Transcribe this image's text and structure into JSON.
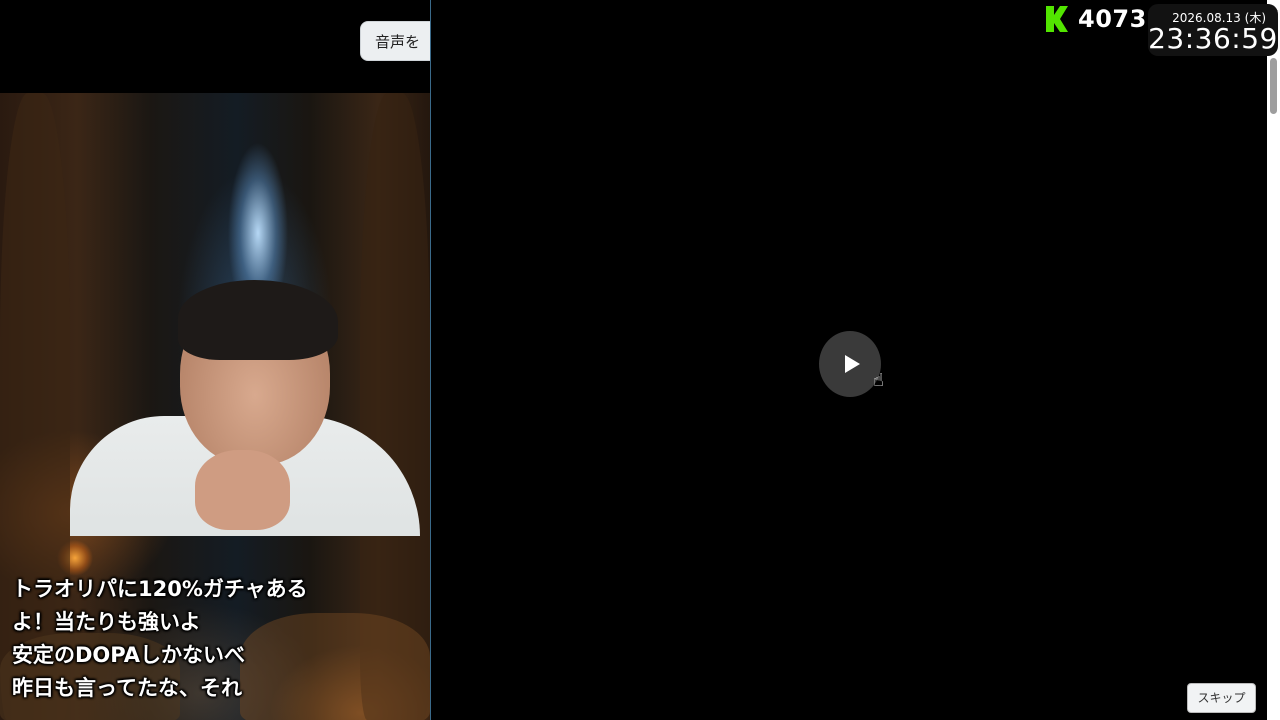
{
  "stream": {
    "audio_button_label": "音声を",
    "subtitles": [
      "トラオリパに120%ガチャある",
      "よ！当たりも強いよ",
      "安定のDOPAしかないべ",
      "昨日も言ってたな、それ"
    ]
  },
  "player": {
    "play_button": "play-icon",
    "skip_label": "スキップ"
  },
  "overlay": {
    "points_icon": "k-icon",
    "points_color": "#52e500",
    "points_value": "4073",
    "date": "2026.08.13 (木)",
    "time": "23:36:59"
  }
}
